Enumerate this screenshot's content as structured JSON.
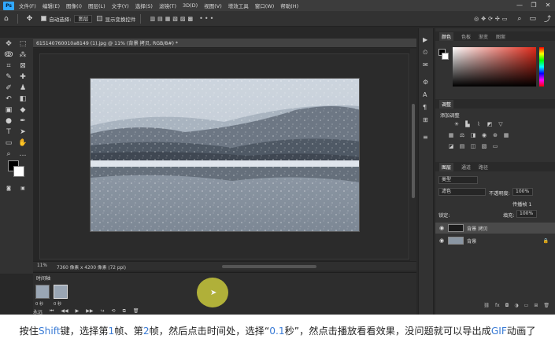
{
  "menubar": {
    "logo": "Ps",
    "items": [
      "文件(F)",
      "编辑(E)",
      "图像(I)",
      "图层(L)",
      "文字(Y)",
      "选择(S)",
      "滤镜(T)",
      "3D(D)",
      "视图(V)",
      "增效工具",
      "窗口(W)",
      "帮助(H)"
    ],
    "window_controls": [
      "—",
      "❐",
      "✕"
    ]
  },
  "options": {
    "auto_select_label": "自动选择:",
    "auto_select_value": "图层",
    "show_transform_label": "显示变换控件",
    "more": "•••"
  },
  "document": {
    "tab_title": "615140760010a8149 (1).jpg @ 11% (背景 拷贝, RGB/8#) *"
  },
  "status": {
    "zoom": "11%",
    "dimensions": "7360 像素 x 4200 像素 (72 ppi)"
  },
  "timeline": {
    "title": "时间轴",
    "frames": [
      {
        "number": "1",
        "delay": "0 秒"
      },
      {
        "number": "2",
        "delay": "0 秒"
      }
    ],
    "loop": "永远",
    "controls": [
      "⏮",
      "◀◀",
      "▶",
      "▶▶",
      "↪",
      "⟲",
      "⧉",
      "🗑"
    ]
  },
  "color_panel": {
    "tabs": [
      "颜色",
      "色板",
      "渐变",
      "图案"
    ],
    "accent": "#e02a1a"
  },
  "adjustments_panel": {
    "tabs": [
      "调整"
    ],
    "add_label": "添加调整"
  },
  "layers_panel": {
    "tabs": [
      "图层",
      "通道",
      "路径"
    ],
    "kind_filter": "类型",
    "blend_mode": "滤色",
    "opacity_label": "不透明度:",
    "opacity_value": "100%",
    "propagate_label": "传播帧 1",
    "lock_label": "锁定:",
    "fill_label": "填充:",
    "fill_value": "100%",
    "layers": [
      {
        "name": "背景 拷贝",
        "selected": true
      },
      {
        "name": "背景",
        "selected": false
      }
    ]
  },
  "caption": {
    "part1": "按住",
    "key": "Shift",
    "part2": "键，选择第",
    "n1": "1",
    "part3": "帧、第",
    "n2": "2",
    "part4": "帧，然后点击时间处，选择“",
    "sec": "0.1",
    "part5": "秒”，然点击播放看看效果，没问题就可以导出成",
    "gif": "GIF",
    "part6": "动画了"
  }
}
